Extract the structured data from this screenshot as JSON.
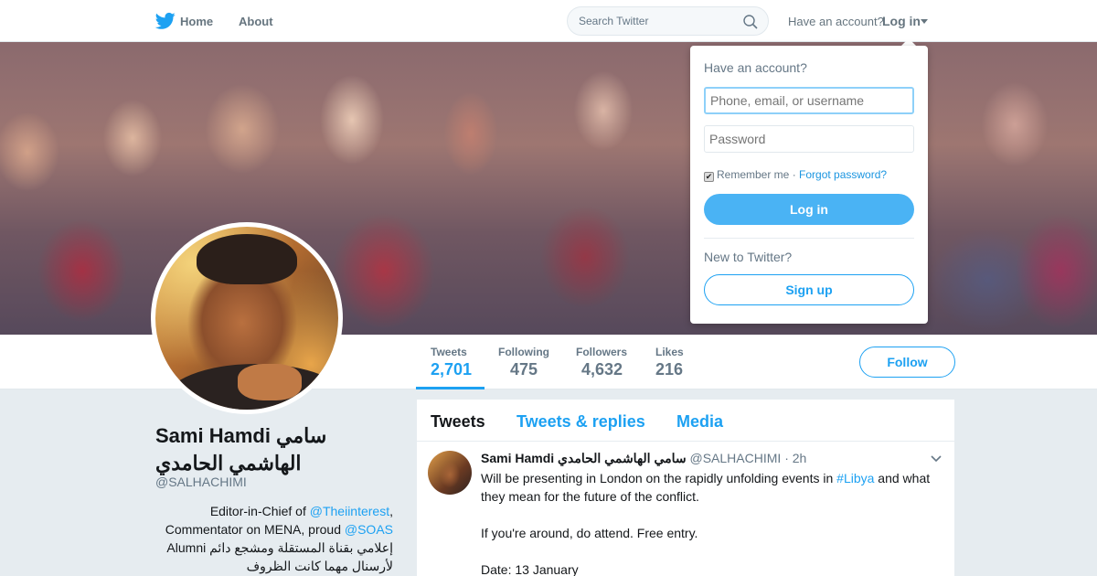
{
  "topbar": {
    "home_label": "Home",
    "about_label": "About",
    "search_placeholder": "Search Twitter",
    "have_account_text": "Have an account?",
    "login_label": "Log in"
  },
  "profile": {
    "name": "Sami Hamdi سامي الهاشمي الحامدي",
    "handle": "@SALHACHIMI",
    "bio": {
      "part1": "Editor-in-Chief of ",
      "link1": "@Theiinterest",
      "part2": ", Commentator on MENA, proud ",
      "link2": "@SOAS",
      "part3": " Alumni إعلامي بقناة المستقلة ومشجع دائم لأرسنال مهما كانت الظروف"
    },
    "stats": [
      {
        "label": "Tweets",
        "value": "2,701"
      },
      {
        "label": "Following",
        "value": "475"
      },
      {
        "label": "Followers",
        "value": "4,632"
      },
      {
        "label": "Likes",
        "value": "216"
      }
    ],
    "follow_label": "Follow"
  },
  "timeline": {
    "tabs": [
      "Tweets",
      "Tweets & replies",
      "Media"
    ],
    "tweet": {
      "fullname": "Sami Hamdi سامي الهاشمي الحامدي",
      "handle": "@SALHACHIMI",
      "time": "· 2h",
      "text_part1": "Will be presenting in London on the rapidly unfolding events in ",
      "hashtag": "#Libya",
      "text_part2": " and what they mean for the future of the conflict.",
      "line2": "If you're around, do attend. Free entry.",
      "line3": "Date: 13 January"
    }
  },
  "login_dropdown": {
    "title": "Have an account?",
    "username_placeholder": "Phone, email, or username",
    "password_placeholder": "Password",
    "remember_label": "Remember me",
    "separator": " · ",
    "forgot_label": "Forgot password?",
    "login_button": "Log in",
    "new_text": "New to Twitter?",
    "signup_button": "Sign up"
  },
  "colors": {
    "accent": "#1da1f2",
    "background": "#e6ecf0",
    "muted_text": "#657786"
  }
}
